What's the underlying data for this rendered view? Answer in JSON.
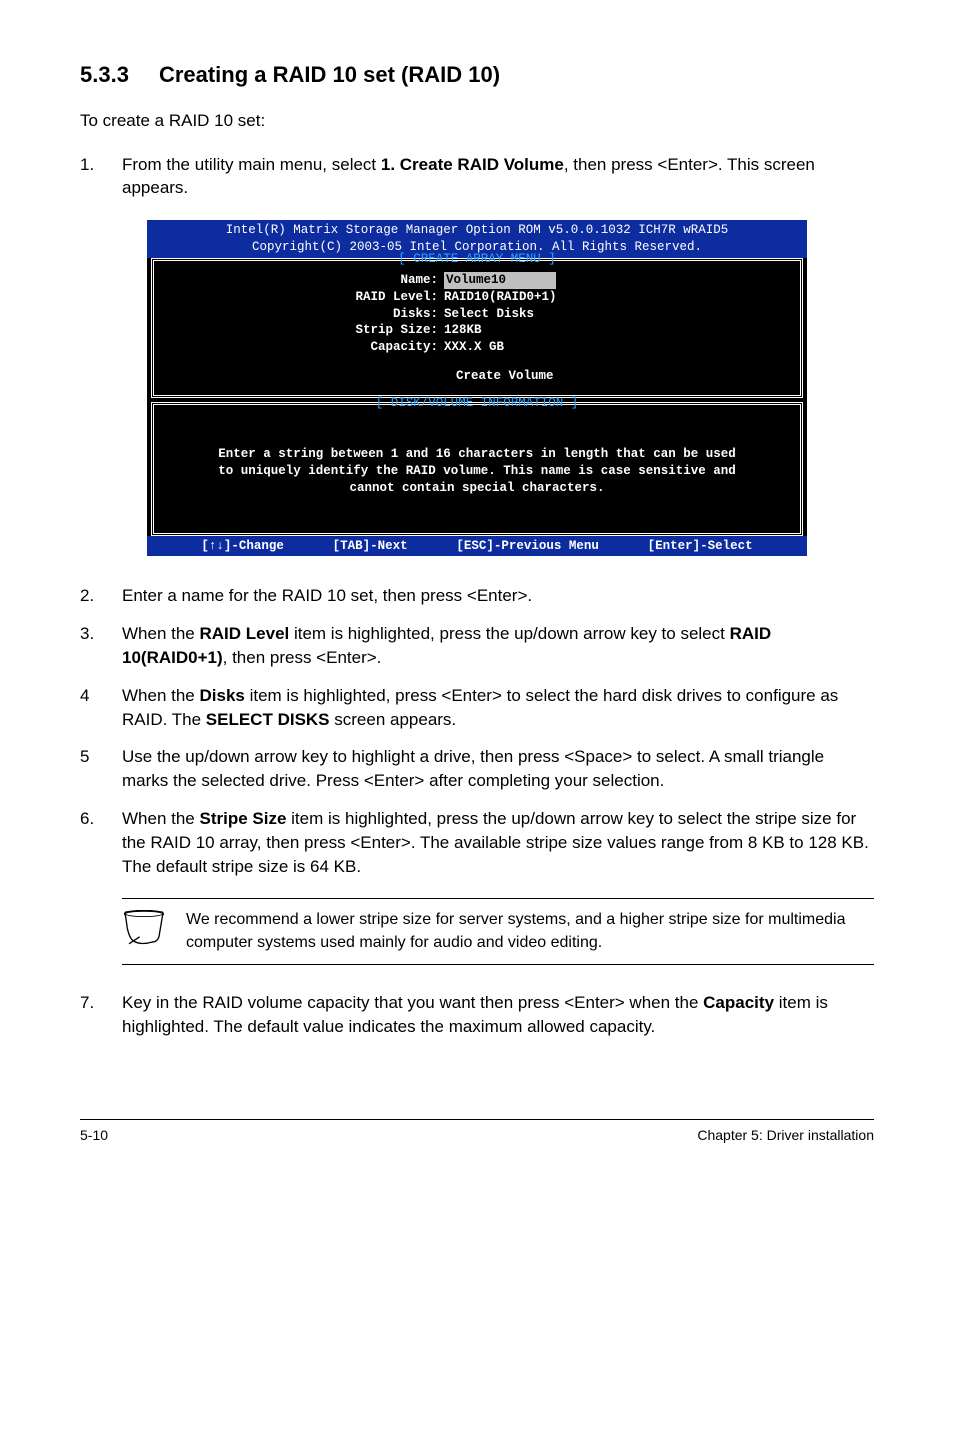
{
  "heading": {
    "number": "5.3.3",
    "title": "Creating a RAID 10 set (RAID 10)"
  },
  "intro": "To create a RAID 10 set:",
  "step1": {
    "num": "1.",
    "text_a": "From the utility main menu, select ",
    "text_bold": "1. Create RAID Volume",
    "text_b": ", then press <Enter>. This screen appears."
  },
  "bios": {
    "header_line1": "Intel(R) Matrix Storage Manager Option ROM v5.0.0.1032 ICH7R wRAID5",
    "header_line2": "Copyright(C) 2003-05 Intel Corporation. All Rights Reserved.",
    "panel1_title": "[ CREATE ARRAY MENU ]",
    "rows": {
      "name_label": "Name:",
      "name_value": "Volume10",
      "raid_label": "RAID Level:",
      "raid_value": "RAID10(RAID0+1)",
      "disks_label": "Disks:",
      "disks_value": "Select Disks",
      "strip_label": "Strip Size:",
      "strip_value": "128KB",
      "cap_label": "Capacity:",
      "cap_value": "XXX.X GB"
    },
    "create_label": "Create Volume",
    "panel2_title": "[ DISK/VOLUME INFORMATION ]",
    "info_line1": "Enter a string between 1 and 16 characters in length that can be used",
    "info_line2": "to uniquely identify the RAID volume. This name is case sensitive and",
    "info_line3": "cannot contain special characters.",
    "footer": {
      "change": "[↑↓]-Change",
      "next": "[TAB]-Next",
      "prev": "[ESC]-Previous Menu",
      "select": "[Enter]-Select"
    }
  },
  "steps": {
    "s2": {
      "num": "2.",
      "text": "Enter a name for the RAID 10 set, then press <Enter>."
    },
    "s3": {
      "num": "3.",
      "a": "When the ",
      "b1": "RAID Level",
      "c": " item is highlighted, press the up/down arrow key to select ",
      "b2": "RAID 10(RAID0+1)",
      "d": ", then press <Enter>."
    },
    "s4": {
      "num": "4",
      "a": "When the ",
      "b1": "Disks",
      "c": " item is highlighted, press <Enter> to select the hard disk drives to configure as RAID. The ",
      "b2": "SELECT DISKS",
      "d": " screen appears."
    },
    "s5": {
      "num": "5",
      "text": "Use the up/down arrow key to highlight a drive, then press <Space>  to select. A small triangle marks the selected drive. Press <Enter> after completing your selection."
    },
    "s6": {
      "num": "6.",
      "a": "When the ",
      "b1": "Stripe Size",
      "c": " item is highlighted, press the up/down arrow key to select the stripe size for the RAID 10 array, then press <Enter>. The available stripe size values range from 8 KB to 128 KB. The default stripe size is 64 KB."
    }
  },
  "note": "We recommend a lower stripe size for server systems, and a higher stripe size for multimedia computer systems used mainly for audio and video editing.",
  "step7": {
    "num": "7.",
    "a": "Key in the RAID volume capacity that you want then press <Enter> when the ",
    "b": "Capacity",
    "c": " item is highlighted. The default value indicates the maximum allowed capacity."
  },
  "footer": {
    "left": "5-10",
    "right": "Chapter 5: Driver installation"
  }
}
